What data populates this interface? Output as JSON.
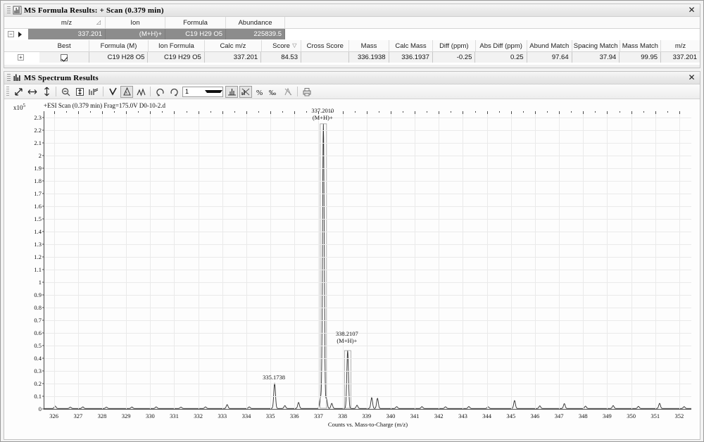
{
  "formula_window": {
    "title": "MS Formula Results: + Scan (0.379 min)",
    "close_label": "✕",
    "top_table": {
      "headers": [
        "m/z",
        "Ion",
        "Formula",
        "Abundance"
      ],
      "sort_mark": "◿",
      "row": [
        "337.201",
        "(M+H)+",
        "C19 H29 O5",
        "225839.5"
      ],
      "expander": "−",
      "row_pointer": "▶"
    },
    "detail_table": {
      "headers": [
        "Best",
        "Formula (M)",
        "Ion Formula",
        "Calc m/z",
        "Score",
        "Cross Score",
        "Mass",
        "Calc Mass",
        "Diff (ppm)",
        "Abs Diff (ppm)",
        "Abund Match",
        "Spacing Match",
        "Mass Match",
        "m/z"
      ],
      "score_sort_mark": "▽",
      "expander": "+",
      "row": {
        "best_checked": true,
        "formula_m": "C19 H28 O5",
        "ion_formula": "C19 H29 O5",
        "calc_mz": "337.201",
        "score": "84.53",
        "cross_score": "",
        "mass": "336.1938",
        "calc_mass": "336.1937",
        "diff_ppm": "-0.25",
        "abs_diff_ppm": "0.25",
        "abund_match": "97.64",
        "spacing_match": "37.94",
        "mass_match": "99.95",
        "mz": "337.201"
      }
    }
  },
  "spectrum_window": {
    "title": "MS Spectrum Results",
    "close_label": "✕",
    "toolbar": {
      "buttons": [
        {
          "name": "zoom-full-icon",
          "glyph": "⤢"
        },
        {
          "name": "zoom-horizontal-icon",
          "glyph": "↔"
        },
        {
          "name": "zoom-vertical-icon",
          "glyph": "↕"
        },
        {
          "name": "zoom-out-icon",
          "glyph": "⊖"
        },
        {
          "name": "autoscale-y-icon",
          "glyph": "⇳"
        },
        {
          "name": "normalize-icon",
          "glyph": "⇶"
        },
        {
          "name": "peak-select-icon",
          "glyph": "✔"
        },
        {
          "name": "annotate-peaks-icon",
          "glyph": "⛰"
        },
        {
          "name": "overlay-spectra-icon",
          "glyph": "⩙"
        },
        {
          "name": "undo-zoom-icon",
          "glyph": "↺"
        },
        {
          "name": "redo-zoom-icon",
          "glyph": "↻"
        }
      ],
      "combo_value": "1",
      "right_buttons": [
        {
          "name": "centroid-view-icon",
          "glyph": "⫯"
        },
        {
          "name": "percent-scale-icon",
          "glyph": "℀"
        },
        {
          "name": "percent-icon",
          "glyph": "%"
        },
        {
          "name": "permille-icon",
          "glyph": "‰"
        },
        {
          "name": "subtract-spectrum-icon",
          "glyph": "⧄"
        },
        {
          "name": "print-icon",
          "glyph": "⎙"
        }
      ]
    }
  },
  "chart_data": {
    "type": "line",
    "title": "+ESI Scan (0.379 min) Frag=175.0V D0-10-2.d",
    "xlabel": "Counts vs. Mass-to-Charge (m/z)",
    "ylabel": "",
    "y_exponent_label": "x10",
    "y_exponent_value": "5",
    "xlim": [
      325.6,
      352.5
    ],
    "ylim": [
      0,
      2.35
    ],
    "xticks": [
      326,
      327,
      328,
      329,
      330,
      331,
      332,
      333,
      334,
      335,
      336,
      337,
      338,
      339,
      340,
      341,
      342,
      343,
      344,
      345,
      346,
      347,
      348,
      349,
      350,
      351,
      352
    ],
    "yticks": [
      0,
      0.1,
      0.2,
      0.3,
      0.4,
      0.5,
      0.6,
      0.7,
      0.8,
      0.9,
      1,
      1.1,
      1.2,
      1.3,
      1.4,
      1.5,
      1.6,
      1.7,
      1.8,
      1.9,
      2,
      2.1,
      2.2,
      2.3
    ],
    "ytick_labels": [
      "0",
      "0.1",
      "0.2",
      "0.3",
      "0.4",
      "0.5",
      "0.6",
      "0.7",
      "0.8",
      "0.9",
      "1",
      "1.1",
      "1.2",
      "1.3",
      "1.4",
      "1.5",
      "1.6",
      "1.7",
      "1.8",
      "1.9",
      "2",
      "2.1",
      "2.2",
      "2.3"
    ],
    "grid": true,
    "annotations": [
      {
        "x": 337.201,
        "y": 2.26,
        "text": "337.2010",
        "text2": "(M+H)+"
      },
      {
        "x": 338.2107,
        "y": 0.5,
        "text": "338.2107",
        "text2": "(M+H)+"
      },
      {
        "x": 335.1738,
        "y": 0.21,
        "text": "335.1738",
        "text2": ""
      }
    ],
    "peaks": [
      {
        "mz": 326.05,
        "intensity": 0.018
      },
      {
        "mz": 326.68,
        "intensity": 0.01
      },
      {
        "mz": 327.2,
        "intensity": 0.012
      },
      {
        "mz": 328.18,
        "intensity": 0.01
      },
      {
        "mz": 329.24,
        "intensity": 0.011
      },
      {
        "mz": 330.25,
        "intensity": 0.012
      },
      {
        "mz": 331.28,
        "intensity": 0.01
      },
      {
        "mz": 332.3,
        "intensity": 0.012
      },
      {
        "mz": 333.2,
        "intensity": 0.03
      },
      {
        "mz": 334.12,
        "intensity": 0.012
      },
      {
        "mz": 335.1738,
        "intensity": 0.2
      },
      {
        "mz": 335.6,
        "intensity": 0.022
      },
      {
        "mz": 336.17,
        "intensity": 0.047
      },
      {
        "mz": 337.201,
        "intensity": 2.245
      },
      {
        "mz": 337.08,
        "intensity": 0.085
      },
      {
        "mz": 337.33,
        "intensity": 0.075
      },
      {
        "mz": 337.55,
        "intensity": 0.04
      },
      {
        "mz": 338.2107,
        "intensity": 0.455
      },
      {
        "mz": 338.6,
        "intensity": 0.025
      },
      {
        "mz": 339.21,
        "intensity": 0.085
      },
      {
        "mz": 339.45,
        "intensity": 0.08
      },
      {
        "mz": 340.25,
        "intensity": 0.014
      },
      {
        "mz": 341.3,
        "intensity": 0.014
      },
      {
        "mz": 342.28,
        "intensity": 0.013
      },
      {
        "mz": 343.25,
        "intensity": 0.015
      },
      {
        "mz": 344.05,
        "intensity": 0.013
      },
      {
        "mz": 345.15,
        "intensity": 0.062
      },
      {
        "mz": 346.2,
        "intensity": 0.02
      },
      {
        "mz": 347.22,
        "intensity": 0.038
      },
      {
        "mz": 348.1,
        "intensity": 0.018
      },
      {
        "mz": 349.25,
        "intensity": 0.022
      },
      {
        "mz": 350.3,
        "intensity": 0.016
      },
      {
        "mz": 351.18,
        "intensity": 0.04
      },
      {
        "mz": 352.2,
        "intensity": 0.014
      }
    ]
  }
}
